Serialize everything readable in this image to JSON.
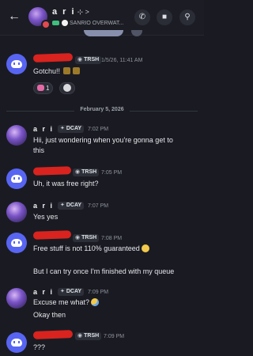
{
  "header": {
    "back_icon": "arrow-left-icon",
    "name": "a r i",
    "name_suffix": "⊹ >",
    "subtitle": "SANRIO OVERWAT...",
    "status_color": "#e14b50",
    "call_icon": "phone-icon",
    "video_icon": "video-camera-icon",
    "search_icon": "search-icon"
  },
  "messages": [
    {
      "author": "redacted",
      "tag": "TRSH",
      "time": "1/5/26, 11:41 AM",
      "lines": [
        "Gotchu!!"
      ],
      "reactions": [
        {
          "count": "1"
        },
        {
          "count": ""
        }
      ]
    },
    {
      "divider": "February 5, 2026"
    },
    {
      "author": "a r i",
      "tag": "DCAY",
      "time": "7:02 PM",
      "lines": [
        "Hii, just wondering when you're gonna get to",
        "this"
      ]
    },
    {
      "author": "redacted",
      "tag": "TRSH",
      "time": "7:05 PM",
      "lines": [
        "Uh, it was free right?"
      ]
    },
    {
      "author": "a r i",
      "tag": "DCAY",
      "time": "7:07 PM",
      "lines": [
        "Yes yes"
      ]
    },
    {
      "author": "redacted",
      "tag": "TRSH",
      "time": "7:08 PM",
      "lines": [
        "Free stuff is not 110% guaranteed",
        "But I can try once I'm finished with my queue"
      ]
    },
    {
      "author": "a r i",
      "tag": "DCAY",
      "time": "7:09 PM",
      "lines": [
        "Excuse me what?",
        "Okay then"
      ]
    },
    {
      "author": "redacted",
      "tag": "TRSH",
      "time": "7:09 PM",
      "lines": [
        "???"
      ]
    }
  ],
  "accent": "#5865f2"
}
